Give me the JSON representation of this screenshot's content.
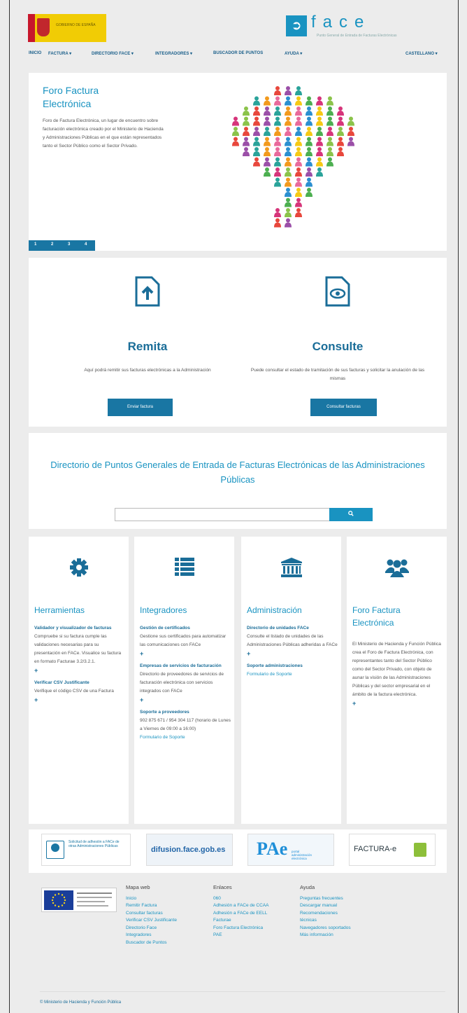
{
  "header": {
    "gov_logo_text": "GOBIERNO DE ESPAÑA",
    "face_logo_word": "face",
    "face_logo_sub": "Punto General de Entrada de Facturas Electrónicas"
  },
  "nav": {
    "items": [
      "INICIO",
      "FACTURA ▾",
      "DIRECTORIO FACE ▾",
      "INTEGRADORES ▾",
      "BUSCADOR DE PUNTOS",
      "AYUDA ▾"
    ],
    "language": "CASTELLANO ▾"
  },
  "slider": {
    "title": "Foro Factura Electrónica",
    "text": "Foro de Factura Electrónica, un lugar de encuentro sobre facturación electrónica creado por el Ministerio de Hacienda y Administraciones Públicas en el que están representados tanto el Sector Público como el Sector Privado.",
    "pages": [
      "1",
      "2",
      "3",
      "4"
    ]
  },
  "remita": {
    "title": "Remita",
    "text": "Aquí podrá remitir sus facturas electrónicas a la Administración",
    "button": "Enviar factura"
  },
  "consulte": {
    "title": "Consulte",
    "text": "Puede consultar el estado de tramitación de sus facturas y solicitar la anulación de las mismas",
    "button": "Consultar facturas"
  },
  "directory": {
    "title": "Directorio de Puntos Generales de Entrada de Facturas Electrónicas de las Administraciones Públicas",
    "search_value": "",
    "search_button_icon": "search-icon"
  },
  "columns": {
    "herramientas": {
      "title": "Herramientas",
      "h1": "Validador y visualizador de facturas",
      "t1": "Compruebe si su factura cumple las validaciones necesarias para su presentación en FACe. Visualice su factura en formato Facturae 3.2/3.2.1.",
      "h2": "Verificar CSV Justificante",
      "t2": "Verifique el código CSV de una Factura"
    },
    "integradores": {
      "title": "Integradores",
      "h1": "Gestión de certificados",
      "t1": "Gestione sus certificados para automatizar las comunicaciones con FACe",
      "h2": "Empresas de servicios de facturación",
      "t2": "Directorio de proveedores de servicios de facturación electrónica con servicios integrados con FACe",
      "h3": "Soporte a proveedores",
      "t3": "902 875 671 / 954 304 117 (horario de Lunes a Viernes de 09:00 a 16:00)",
      "l3": "Formulario de Soporte"
    },
    "administracion": {
      "title": "Administración",
      "h1": "Directorio de unidades FACe",
      "t1": "Consulte el listado de unidades de las Administraciones Públicas adheridas a FACe",
      "h2": "Soporte administraciones",
      "l2": "Formulario de Soporte"
    },
    "foro": {
      "title": "Foro Factura Electrónica",
      "t1": "El Ministerio de Hacienda y Función Pública crea el Foro de Factura Electrónica, con representantes tanto del Sector Público como del Sector Privado, con objeto de aunar la visión de las Administraciones Públicas y del sector empresarial en el ámbito de la factura electrónica."
    },
    "more_icon": "+"
  },
  "banners": {
    "b1": "Solicitud de adhesión a FACe de otras Administraciones Públicas",
    "b2": "difusion.face.gob.es",
    "b3": "PAe",
    "b3_sub": "portal administración electrónica",
    "b4": "FACTURA-e"
  },
  "footer": {
    "mapa": {
      "title": "Mapa web",
      "links": [
        "Inicio",
        "Remitir Factura",
        "Consultar facturas",
        "Verificar CSV Justificante",
        "Directorio Face",
        "Integradores",
        "Buscador de Puntos"
      ]
    },
    "enlaces": {
      "title": "Enlaces",
      "links": [
        "060",
        "Adhesión a FACe de CCAA",
        "Adhesión a FACe de EELL",
        "Facturae",
        "Foro Factura Electrónica",
        "PAE"
      ]
    },
    "ayuda": {
      "title": "Ayuda",
      "links": [
        "Preguntas frecuentes",
        "Descargar manual",
        "Recomendaciones",
        "técnicas",
        "Navegadores soportados",
        "Más información"
      ]
    },
    "copyright": "© Ministerio de Hacienda y Función Pública"
  },
  "colors": {
    "accent": "#1993c1",
    "dark_accent": "#1976a3",
    "background": "#ececec"
  }
}
